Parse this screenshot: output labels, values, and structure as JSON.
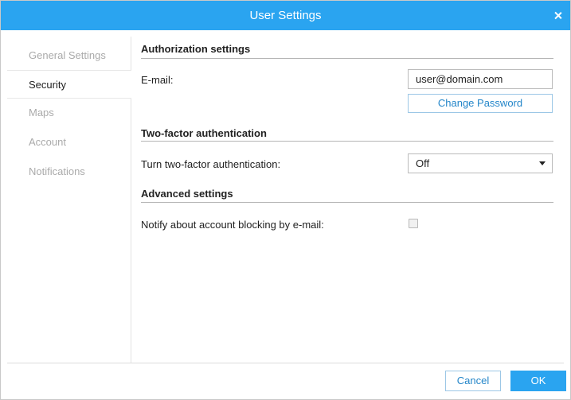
{
  "dialog": {
    "title": "User Settings"
  },
  "sidebar": {
    "items": [
      {
        "label": "General Settings",
        "active": false
      },
      {
        "label": "Security",
        "active": true
      },
      {
        "label": "Maps",
        "active": false
      },
      {
        "label": "Account",
        "active": false
      },
      {
        "label": "Notifications",
        "active": false
      }
    ]
  },
  "security": {
    "authorization": {
      "title": "Authorization settings",
      "email_label": "E-mail:",
      "email_value": "user@domain.com",
      "change_password_label": "Change Password"
    },
    "two_factor": {
      "title": "Two-factor authentication",
      "toggle_label": "Turn two-factor authentication:",
      "toggle_value": "Off"
    },
    "advanced": {
      "title": "Advanced settings",
      "notify_label": "Notify about account blocking by e-mail:",
      "notify_checked": false
    }
  },
  "footer": {
    "cancel_label": "Cancel",
    "ok_label": "OK"
  },
  "colors": {
    "accent": "#2aa4f0",
    "link": "#2486c9",
    "muted_text": "#aaaaaa"
  }
}
